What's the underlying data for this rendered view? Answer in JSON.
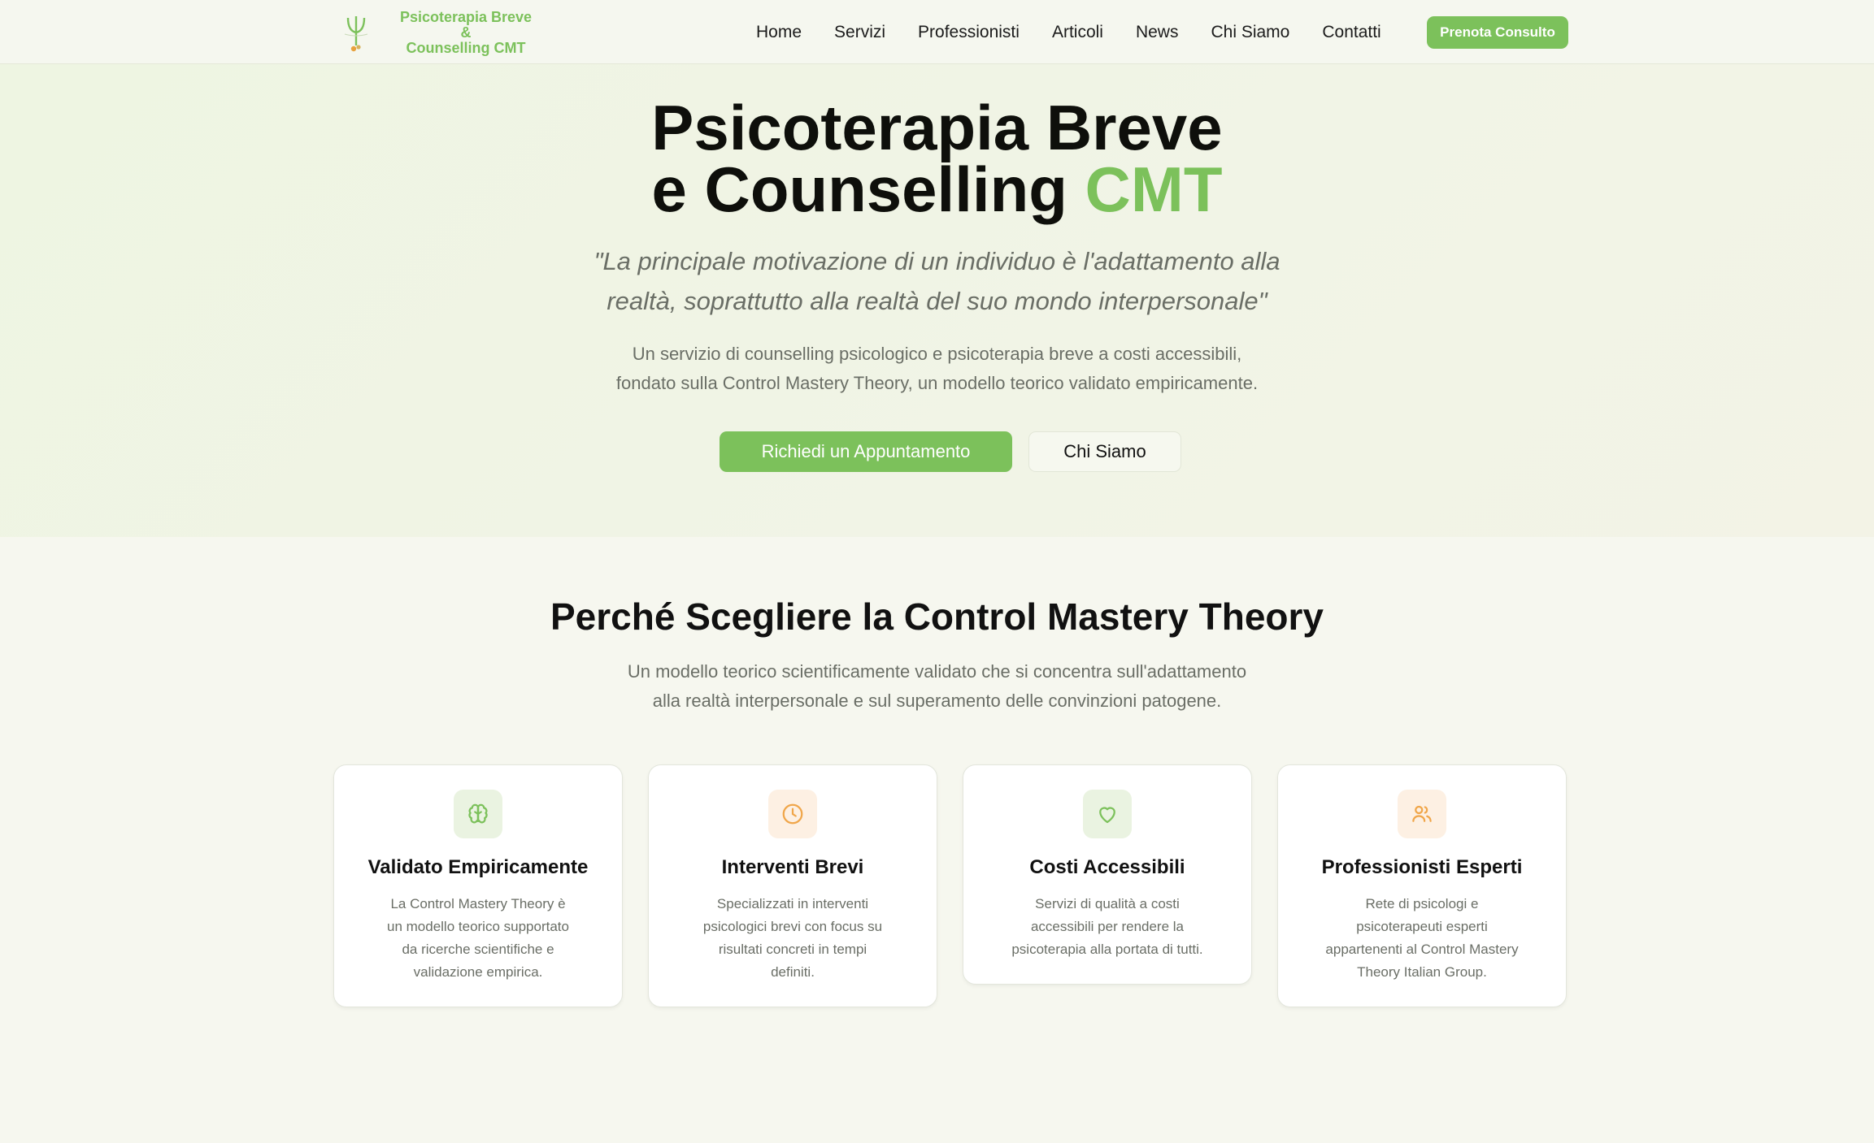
{
  "brand": {
    "line1": "Psicoterapia Breve",
    "line2": "&",
    "line3": "Counselling CMT"
  },
  "nav": {
    "items": [
      "Home",
      "Servizi",
      "Professionisti",
      "Articoli",
      "News",
      "Chi Siamo",
      "Contatti"
    ],
    "cta": "Prenota Consulto"
  },
  "hero": {
    "title_line1": "Psicoterapia Breve",
    "title_line2_pre": "e Counselling",
    "title_line2_accent": "CMT",
    "quote_line1": "\"La principale motivazione di un individuo è l'adattamento alla",
    "quote_line2": "realtà, soprattutto alla realtà del suo mondo interpersonale\"",
    "desc_line1": "Un servizio di counselling psicologico e psicoterapia breve a costi accessibili,",
    "desc_line2": "fondato sulla Control Mastery Theory, un modello teorico validato empiricamente.",
    "primary_button": "Richiedi un Appuntamento",
    "secondary_button": "Chi Siamo"
  },
  "features": {
    "title": "Perché Scegliere la Control Mastery Theory",
    "sub_line1": "Un modello teorico scientificamente validato che si concentra sull'adattamento",
    "sub_line2": "alla realtà interpersonale e sul superamento delle convinzioni patogene.",
    "cards": [
      {
        "icon": "brain-icon",
        "title": "Validato Empiricamente",
        "text": "La Control Mastery Theory è un modello teorico supportato da ricerche scientifiche e validazione empirica."
      },
      {
        "icon": "clock-icon",
        "title": "Interventi Brevi",
        "text": "Specializzati in interventi psicologici brevi con focus su risultati concreti in tempi definiti."
      },
      {
        "icon": "heart-icon",
        "title": "Costi Accessibili",
        "text": "Servizi di qualità a costi accessibili per rendere la psicoterapia alla portata di tutti."
      },
      {
        "icon": "users-icon",
        "title": "Professionisti Esperti",
        "text": "Rete di psicologi e psicoterapeuti esperti appartenenti al Control Mastery Theory Italian Group."
      }
    ]
  },
  "colors": {
    "accent": "#7cc15b",
    "accent_orange": "#f0a64a",
    "text_muted": "#6a6e66"
  }
}
